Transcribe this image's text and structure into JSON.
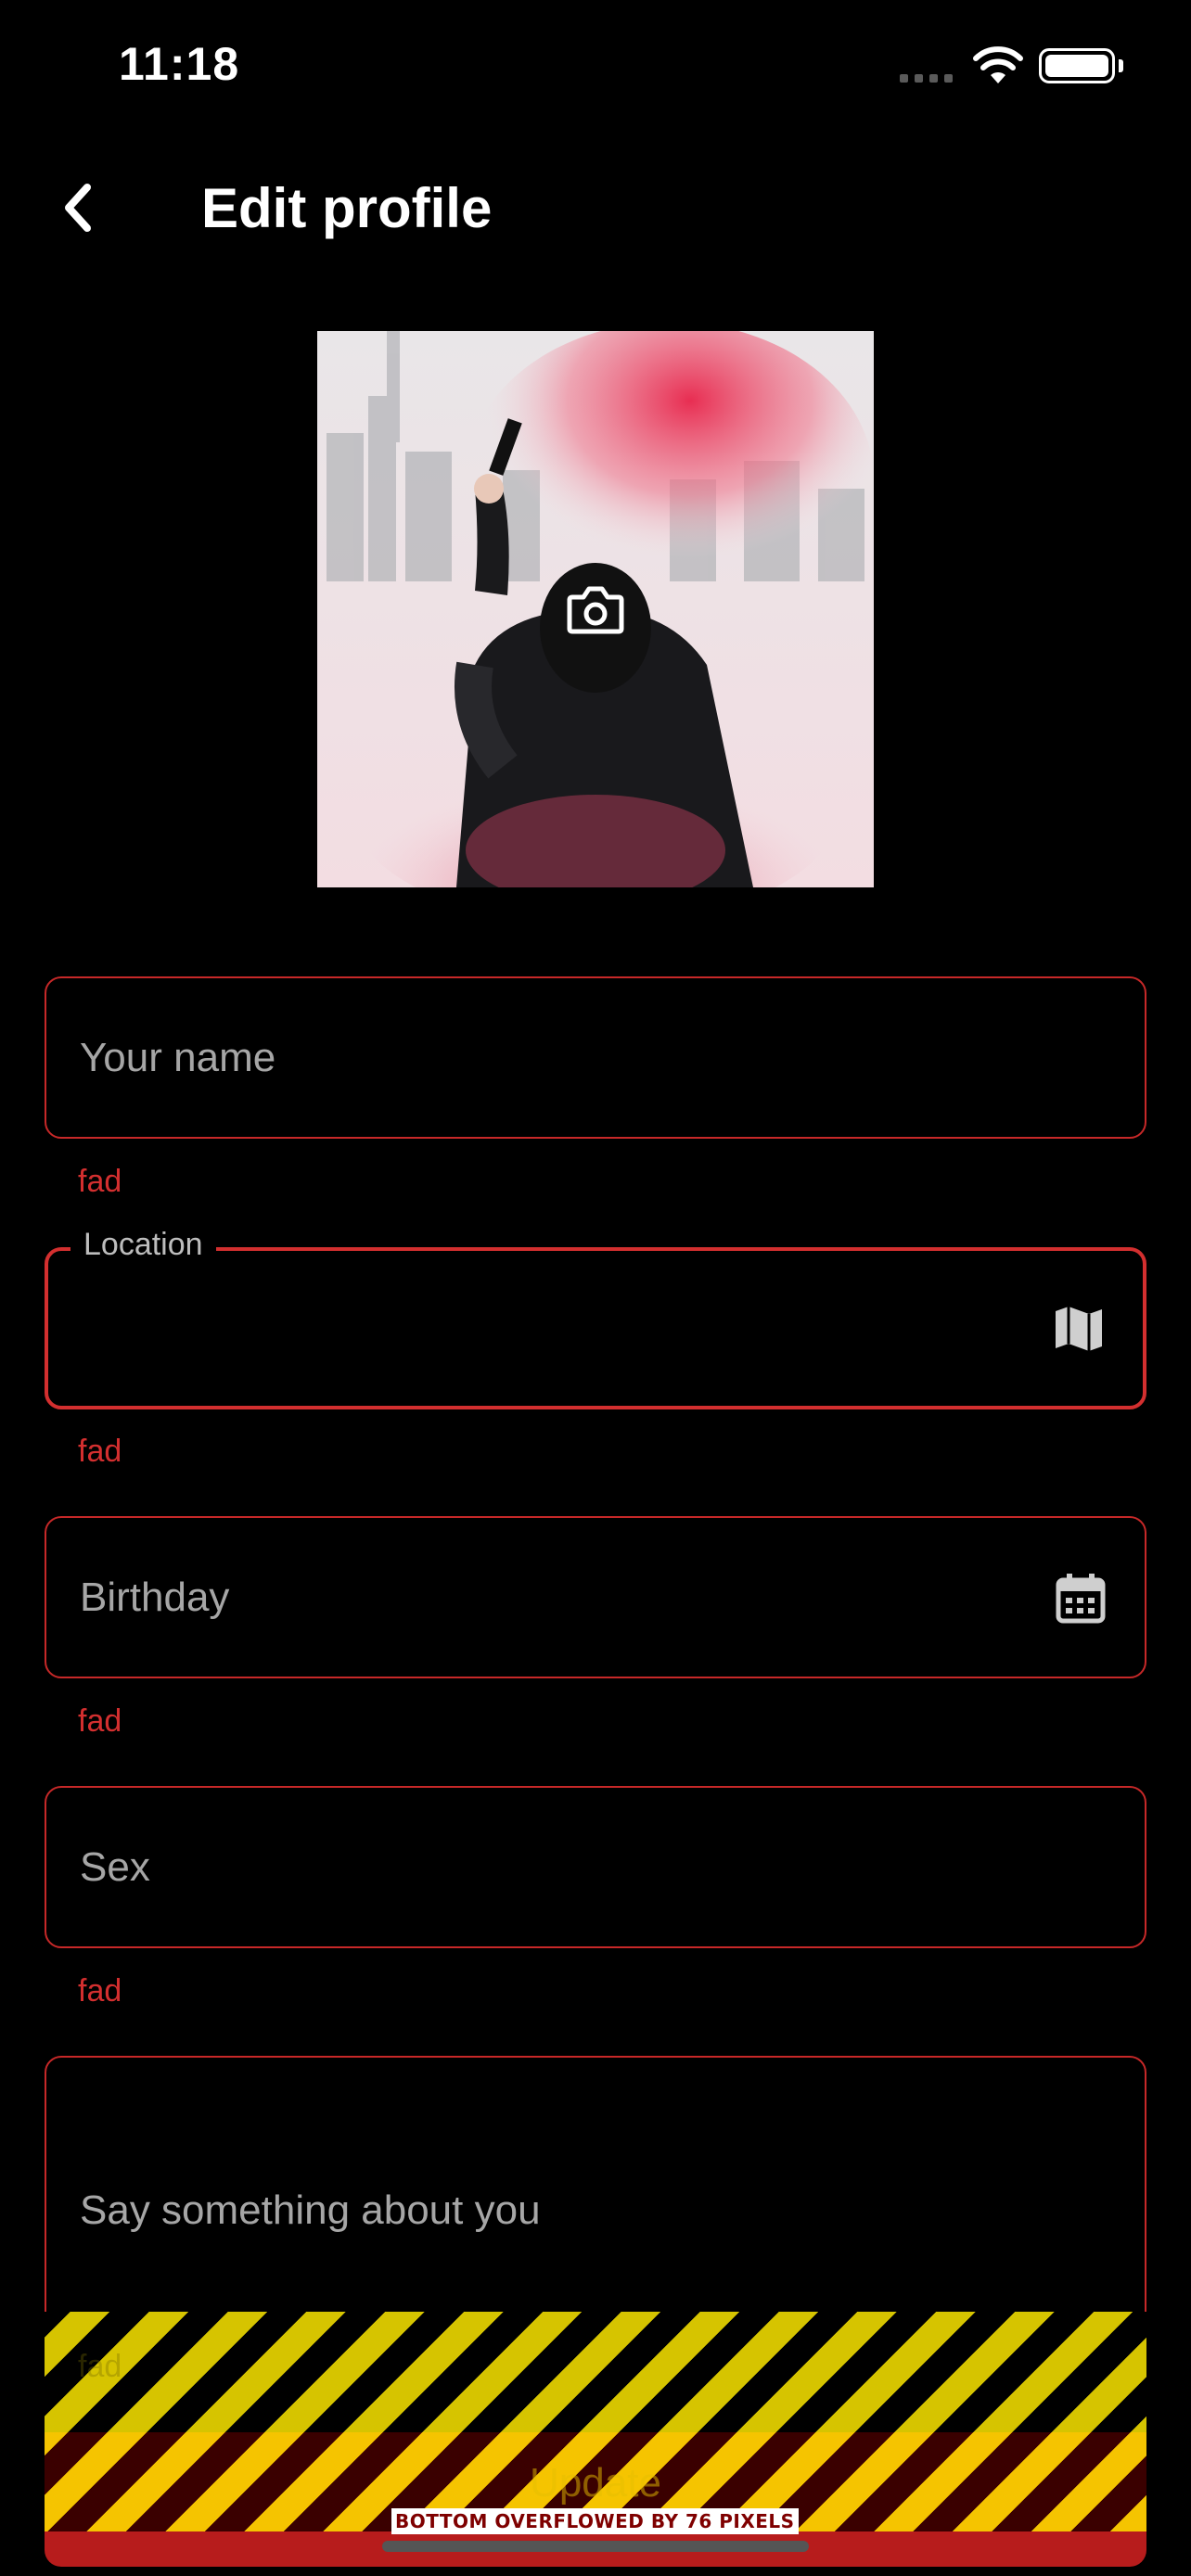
{
  "status_bar": {
    "time": "11:18"
  },
  "header": {
    "title": "Edit profile",
    "back_icon": "chevron-left-icon"
  },
  "avatar": {
    "camera_icon": "camera-icon"
  },
  "fields": {
    "name": {
      "placeholder": "Your name",
      "error": "fad"
    },
    "location": {
      "label": "Location",
      "value": "",
      "error": "fad",
      "icon": "map-icon"
    },
    "birthday": {
      "placeholder": "Birthday",
      "error": "fad",
      "icon": "calendar-icon"
    },
    "sex": {
      "placeholder": "Sex",
      "error": "fad"
    },
    "about": {
      "placeholder": "Say something about you",
      "error": "fad"
    }
  },
  "update_button": {
    "label": "Update"
  },
  "overflow_warning": {
    "text": "BOTTOM OVERFLOWED BY 76 PIXELS"
  },
  "colors": {
    "background": "#000000",
    "error": "#d32f2f",
    "field_border": "#c62828",
    "warning_yellow": "#f5c400"
  }
}
